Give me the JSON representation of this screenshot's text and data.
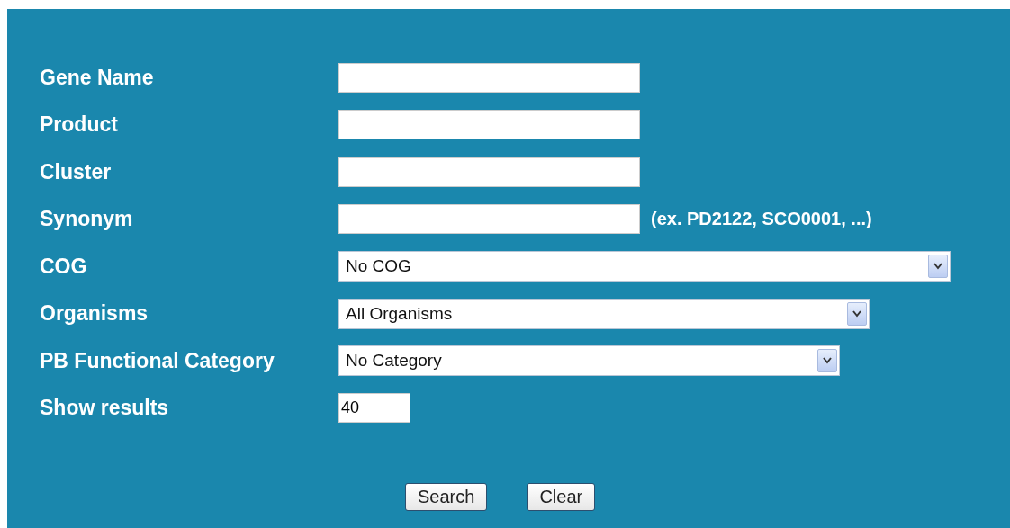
{
  "fields": [
    {
      "kind": "text",
      "label": "Gene Name"
    },
    {
      "kind": "text",
      "label": "Product"
    },
    {
      "kind": "text",
      "label": "Cluster"
    },
    {
      "kind": "text",
      "label": "Synonym",
      "hint": "(ex. PD2122, SCO0001, ...)"
    },
    {
      "kind": "select",
      "label": "COG",
      "value": "No COG"
    },
    {
      "kind": "select",
      "label": "Organisms",
      "value": "All Organisms"
    },
    {
      "kind": "select",
      "label": "PB Functional Category",
      "value": "No Category"
    },
    {
      "kind": "number",
      "label": "Show results",
      "value": "40"
    }
  ],
  "buttons": [
    "Search",
    "Clear"
  ]
}
